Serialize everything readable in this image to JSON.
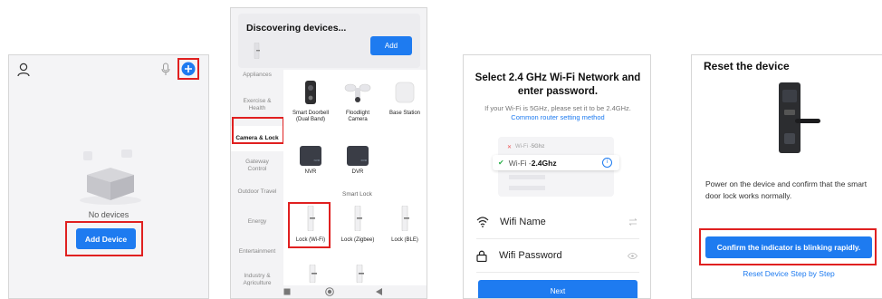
{
  "home": {
    "empty_text": "No devices",
    "add_device_label": "Add Device"
  },
  "discover": {
    "title": "Discovering devices...",
    "add_label": "Add",
    "categories": [
      "Appliances",
      "Exercise & Health",
      "Camera & Lock",
      "Gateway Control",
      "Outdoor Travel",
      "Energy",
      "Entertainment",
      "Industry & Agriculture"
    ],
    "devices_row1": [
      "Smart Doorbell (Dual Band)",
      "Floodlight Camera",
      "Base Station"
    ],
    "devices_row2": [
      "NVR",
      "DVR"
    ],
    "nvr_badge": "NVR",
    "dvr_badge": "DVR",
    "smart_lock_header": "Smart Lock",
    "locks": [
      "Lock (Wi-Fi)",
      "Lock (Zigbee)",
      "Lock (BLE)"
    ]
  },
  "wifi": {
    "title": "Select 2.4 GHz Wi-Fi Network and enter password.",
    "subtitle": "If your Wi-Fi is 5GHz, please set it to be 2.4GHz.",
    "link": "Common router setting method",
    "opt_5g_prefix": "Wi-Fi - ",
    "opt_5g_band": "5Ghz",
    "opt_24_prefix": "Wi-Fi - ",
    "opt_24_band": "2.4Ghz",
    "name_label": "Wifi Name",
    "password_label": "Wifi Password",
    "next_label": "Next"
  },
  "reset": {
    "title": "Reset the device",
    "description": "Power on the device and confirm that the smart door lock works normally.",
    "confirm_label": "Confirm the indicator is blinking rapidly.",
    "step_link": "Reset Device Step by Step"
  },
  "colors": {
    "accent": "#1e7bf0",
    "highlight": "#e02020"
  }
}
